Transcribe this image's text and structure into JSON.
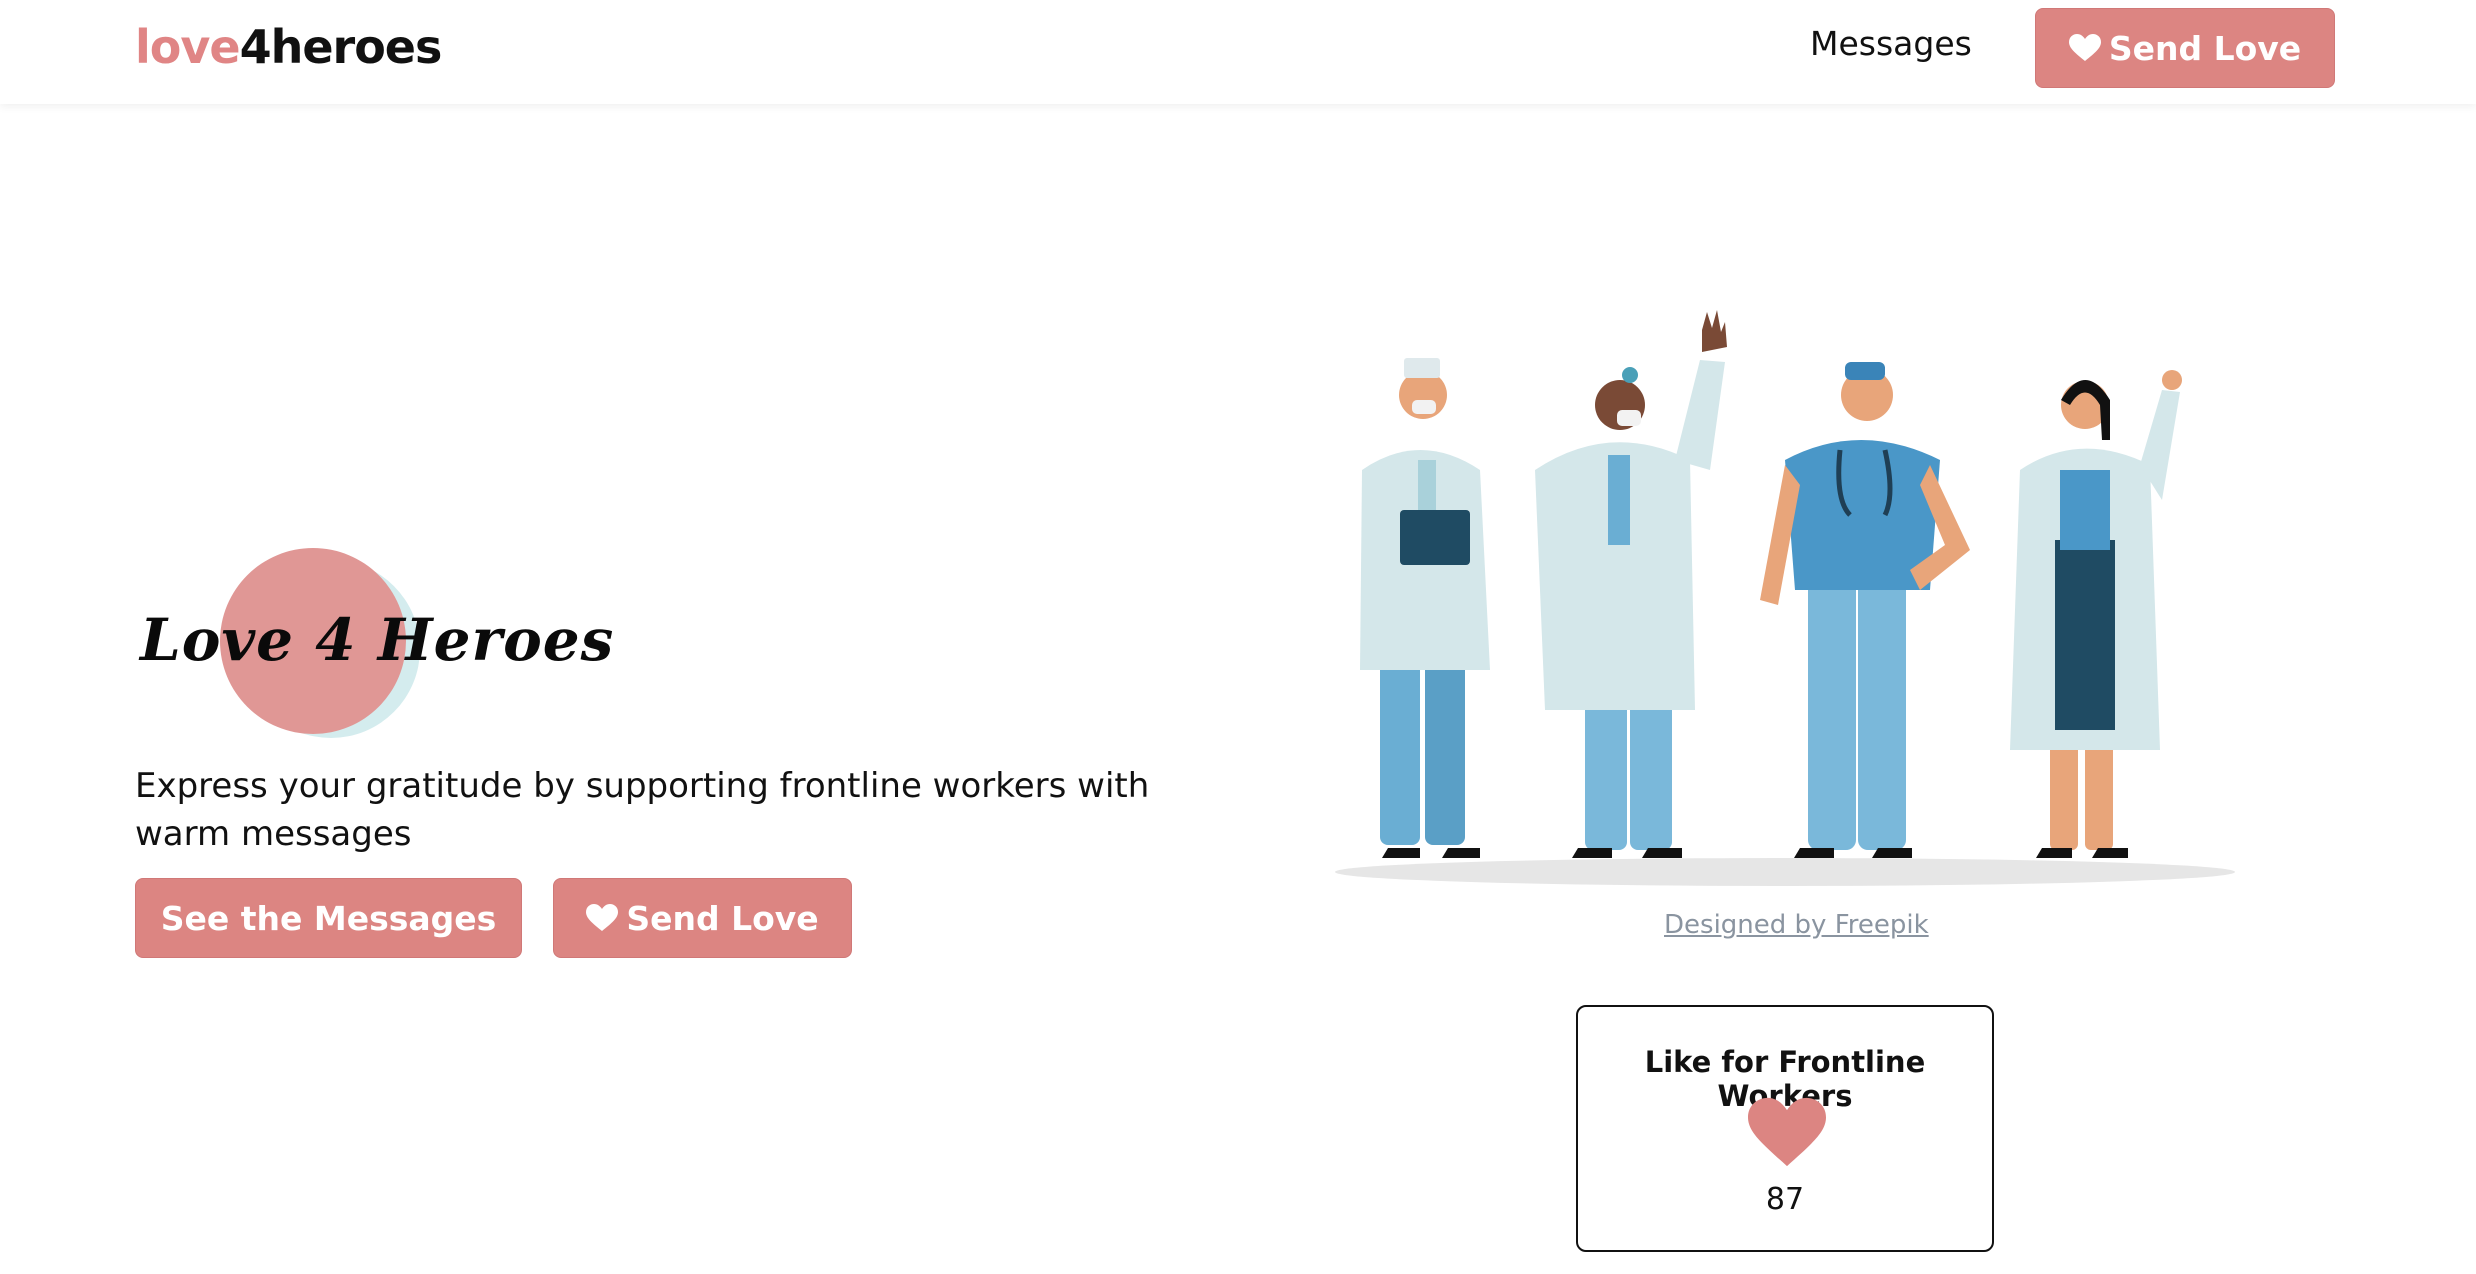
{
  "navbar": {
    "brand_part1": "love",
    "brand_part2": "4heroes",
    "messages_link": "Messages",
    "send_love_label": "Send Love"
  },
  "hero": {
    "title": "Love 4 Heroes",
    "subtitle": "Express your gratitude by supporting frontline workers with warm messages",
    "see_messages_label": "See the Messages",
    "send_love_label": "Send Love"
  },
  "illustration": {
    "credit": "Designed by Freepik"
  },
  "like_card": {
    "title": "Like for Frontline Workers",
    "count": "87"
  },
  "colors": {
    "accent": "#dc8582",
    "brand_pink": "#e08585",
    "circle_pink": "#e09795",
    "circle_teal": "#d4ecee",
    "credit_gray": "#8a94a0"
  },
  "icons": [
    "heart-icon"
  ]
}
